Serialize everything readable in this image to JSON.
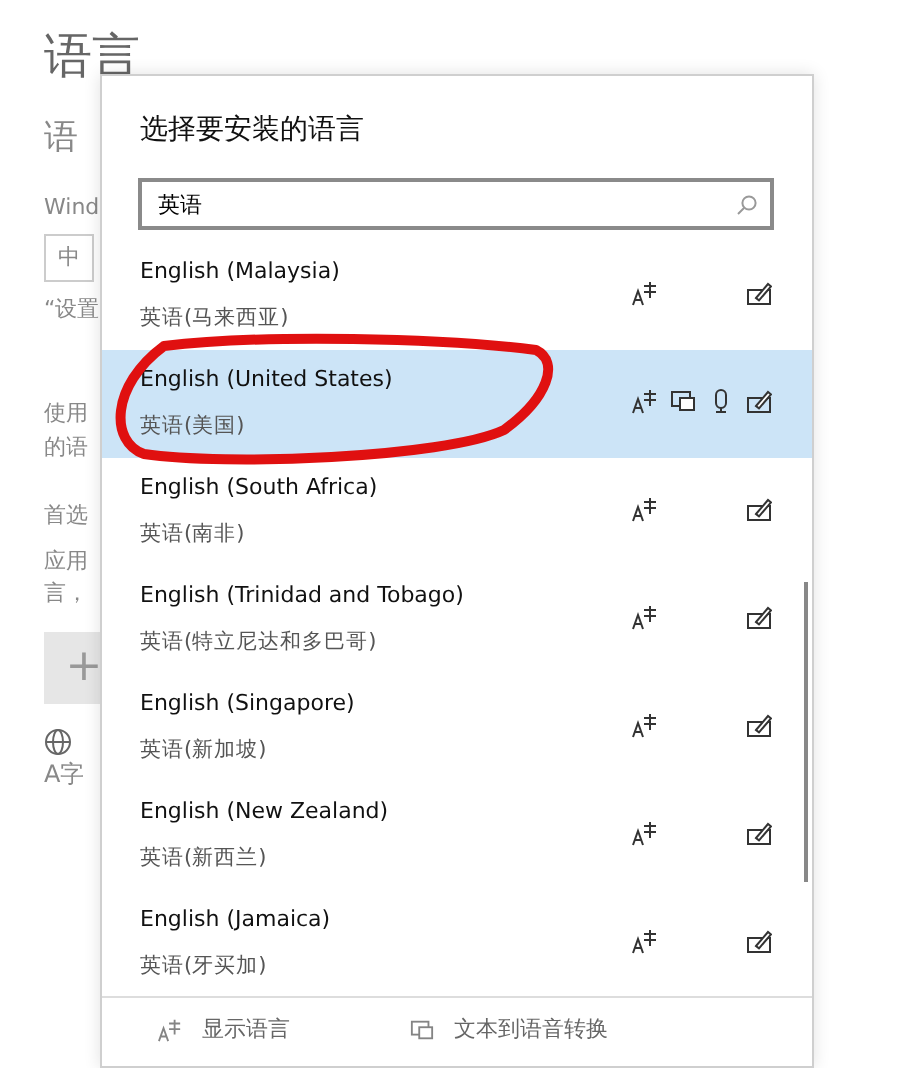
{
  "background_page": {
    "title": "语言",
    "texts": [
      "语",
      "Wind",
      "“设置",
      "使用",
      "的语",
      "首选",
      "应用",
      "言，"
    ],
    "field_value": "中",
    "add_button": "+",
    "globe_label": "A字"
  },
  "dialog": {
    "title": "选择要安装的语言",
    "search": {
      "value": "英语"
    },
    "languages": [
      {
        "name": "English (Malaysia)",
        "native": "英语(马来西亚)",
        "selected": false,
        "features": [
          {
            "kind": "display"
          },
          {
            "kind": "handwriting"
          }
        ]
      },
      {
        "name": "English (United States)",
        "native": "英语(美国)",
        "selected": true,
        "features": [
          {
            "kind": "display"
          },
          {
            "kind": "tts"
          },
          {
            "kind": "speech"
          },
          {
            "kind": "handwriting"
          }
        ]
      },
      {
        "name": "English (South Africa)",
        "native": "英语(南非)",
        "selected": false,
        "features": [
          {
            "kind": "display"
          },
          {
            "kind": "handwriting"
          }
        ]
      },
      {
        "name": "English (Trinidad and Tobago)",
        "native": "英语(特立尼达和多巴哥)",
        "selected": false,
        "features": [
          {
            "kind": "display"
          },
          {
            "kind": "handwriting"
          }
        ]
      },
      {
        "name": "English (Singapore)",
        "native": "英语(新加坡)",
        "selected": false,
        "features": [
          {
            "kind": "display"
          },
          {
            "kind": "handwriting"
          }
        ]
      },
      {
        "name": "English (New Zealand)",
        "native": "英语(新西兰)",
        "selected": false,
        "features": [
          {
            "kind": "display"
          },
          {
            "kind": "handwriting"
          }
        ]
      },
      {
        "name": "English (Jamaica)",
        "native": "英语(牙买加)",
        "selected": false,
        "features": [
          {
            "kind": "display"
          },
          {
            "kind": "handwriting"
          }
        ]
      }
    ],
    "legend": [
      {
        "kind": "display",
        "label": "显示语言"
      },
      {
        "kind": "tts",
        "label": "文本到语音转换"
      }
    ]
  },
  "annotation": {
    "kind": "circle"
  }
}
